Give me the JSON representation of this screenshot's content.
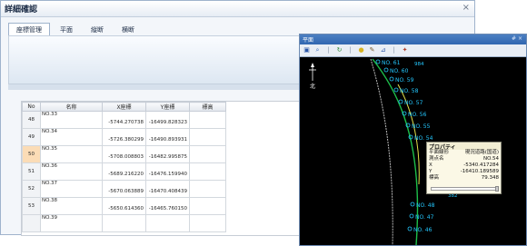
{
  "main_window": {
    "title": "詳細確認",
    "close_glyph": "×",
    "tabs": [
      {
        "label": "座標管理",
        "active": true
      },
      {
        "label": "平面",
        "active": false
      },
      {
        "label": "縦断",
        "active": false
      },
      {
        "label": "横断",
        "active": false
      }
    ]
  },
  "table": {
    "headers": [
      "No",
      "名称",
      "X座標",
      "Y座標",
      "標高"
    ],
    "selected_no": "50",
    "rows": [
      {
        "no": "48",
        "name": "NO.33",
        "x": "-5744.270738",
        "y": "-16499.828323",
        "z": ""
      },
      {
        "no": "49",
        "name": "NO.34",
        "x": "-5726.380299",
        "y": "-16490.893931",
        "z": ""
      },
      {
        "no": "50",
        "name": "NO.35",
        "x": "-5708.008803",
        "y": "-16482.995875",
        "z": ""
      },
      {
        "no": "51",
        "name": "NO.36",
        "x": "-5689.216220",
        "y": "-16476.159940",
        "z": ""
      },
      {
        "no": "52",
        "name": "NO.37",
        "x": "-5670.063889",
        "y": "-16470.408439",
        "z": ""
      },
      {
        "no": "53",
        "name": "NO.38",
        "x": "-5650.614360",
        "y": "-16465.760150",
        "z": ""
      },
      {
        "no": "",
        "name": "NO.39",
        "x": "",
        "y": "",
        "z": ""
      }
    ]
  },
  "plan_window": {
    "title": "平面",
    "controls": "# ×",
    "north_label": "北",
    "stations": [
      {
        "label": "NO. 61"
      },
      {
        "label": "NO. 60"
      },
      {
        "label": "NO. 59"
      },
      {
        "label": "NO. 58"
      },
      {
        "label": "NO. 57"
      },
      {
        "label": "NO. 56"
      },
      {
        "label": "NO. 55"
      },
      {
        "label": "NO. 54"
      },
      {
        "label": "NO. 48"
      },
      {
        "label": "NO. 47"
      },
      {
        "label": "NO. 46"
      }
    ],
    "extra_labels": [
      "984",
      "382"
    ],
    "colors": {
      "stations": "#24c8ff",
      "alignment": "#1dbf4a",
      "road": "#b8b8b8",
      "highlight": "#e3e04a"
    }
  },
  "properties": {
    "title": "プロパティ",
    "rows": [
      {
        "key": "平面線形",
        "value": "現況道路(国道)"
      },
      {
        "key": "測点名",
        "value": "NO.54"
      },
      {
        "key": "X",
        "value": "-5340.417284"
      },
      {
        "key": "Y",
        "value": "-16410.189589"
      },
      {
        "key": "標高",
        "value": "79.348"
      }
    ]
  }
}
